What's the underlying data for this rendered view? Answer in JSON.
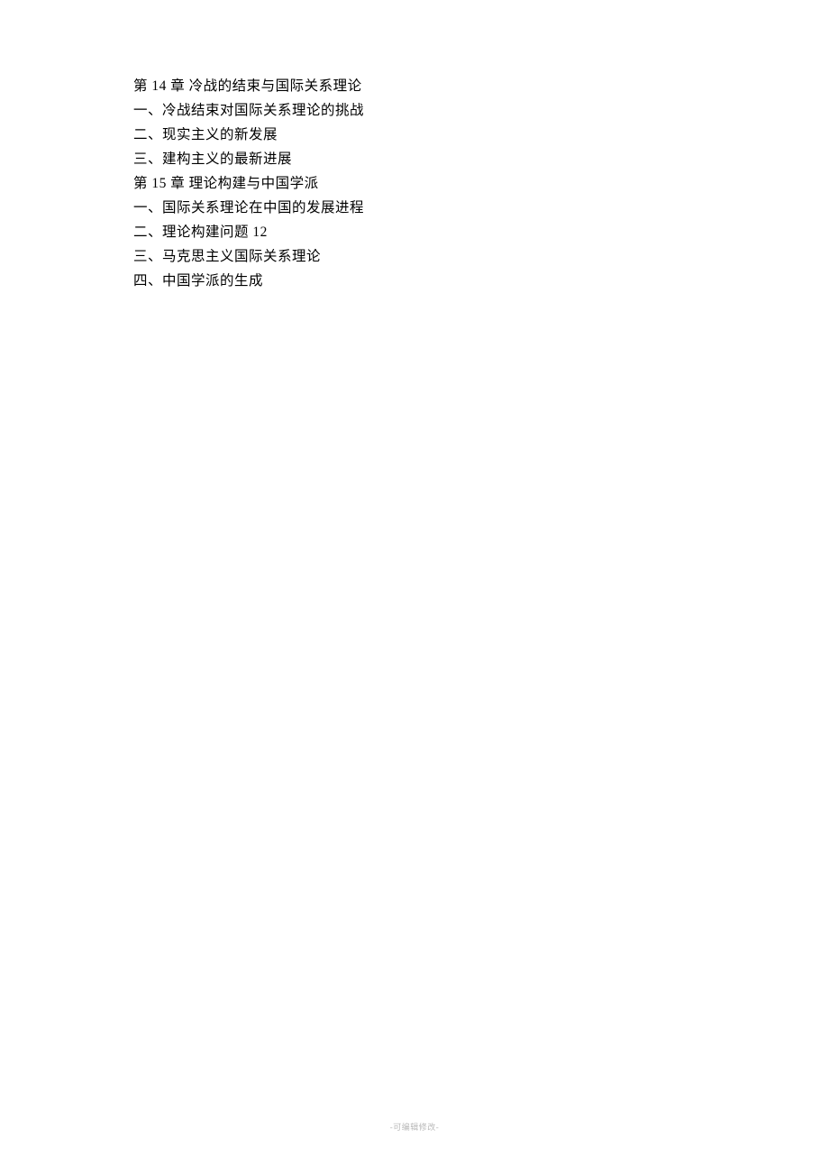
{
  "lines": [
    "第 14 章 冷战的结束与国际关系理论",
    "一、冷战结束对国际关系理论的挑战",
    "二、现实主义的新发展",
    "三、建构主义的最新进展",
    "第 15 章 理论构建与中国学派",
    "一、国际关系理论在中国的发展进程",
    "二、理论构建问题 12",
    "三、马克思主义国际关系理论",
    "四、中国学派的生成"
  ],
  "footer": "-可编辑修改-"
}
